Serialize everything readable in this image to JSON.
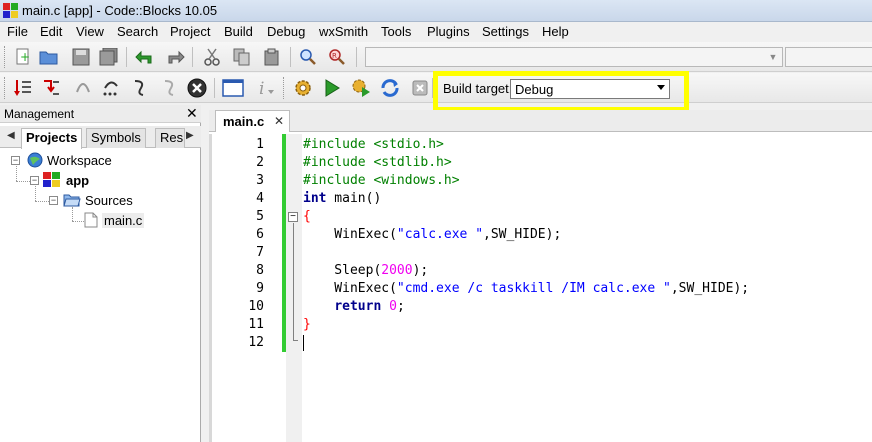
{
  "window": {
    "title": "main.c [app] - Code::Blocks 10.05"
  },
  "menu": [
    "File",
    "Edit",
    "View",
    "Search",
    "Project",
    "Build",
    "Debug",
    "wxSmith",
    "Tools",
    "Plugins",
    "Settings",
    "Help"
  ],
  "toolbar": {
    "build_target_label": "Build target:",
    "build_target_value": "Debug"
  },
  "management": {
    "title": "Management",
    "close": "✕",
    "tabs": [
      "Projects",
      "Symbols",
      "Res"
    ],
    "tree": {
      "workspace": "Workspace",
      "project": "app",
      "folder": "Sources",
      "file": "main.c"
    }
  },
  "editor": {
    "tab_label": "main.c",
    "tab_close": "✕",
    "line_numbers": [
      "1",
      "2",
      "3",
      "4",
      "5",
      "6",
      "7",
      "8",
      "9",
      "10",
      "11",
      "12"
    ],
    "lines": [
      "#include <stdio.h>",
      "#include <stdlib.h>",
      "#include <windows.h>",
      "int main()",
      "{",
      "    WinExec(\"calc.exe \",SW_HIDE);",
      "",
      "    Sleep(2000);",
      "    WinExec(\"cmd.exe /c taskkill /IM calc.exe \",SW_HIDE);",
      "    return 0;",
      "}",
      ""
    ]
  },
  "colors": {
    "highlight": "#ffff00",
    "preprocessor": "#008000",
    "keyword": "#00008b",
    "string": "#0000ff",
    "number": "#f000f0",
    "brace": "#ff0000",
    "change_bar": "#33cc33"
  }
}
